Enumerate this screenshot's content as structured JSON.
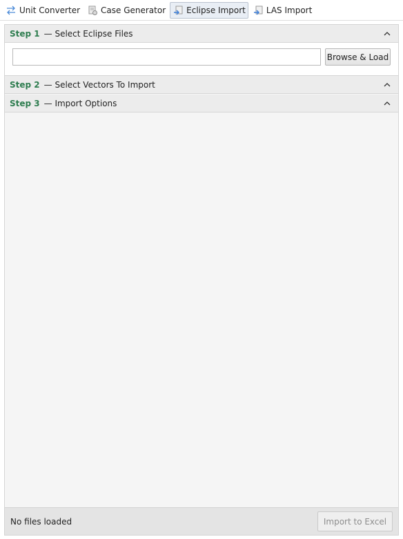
{
  "toolbar": {
    "items": [
      {
        "label": "Unit Converter",
        "icon": "swap-arrows-icon",
        "active": false
      },
      {
        "label": "Case Generator",
        "icon": "document-gear-icon",
        "active": false
      },
      {
        "label": "Eclipse Import",
        "icon": "import-file-icon",
        "active": true
      },
      {
        "label": "LAS Import",
        "icon": "import-file-icon",
        "active": false
      }
    ]
  },
  "steps": [
    {
      "number": "Step 1",
      "title": "— Select Eclipse Files",
      "expanded": true
    },
    {
      "number": "Step 2",
      "title": "— Select Vectors To Import",
      "expanded": false
    },
    {
      "number": "Step 3",
      "title": "— Import Options",
      "expanded": false
    }
  ],
  "step1": {
    "file_input_value": "",
    "browse_label": "Browse & Load"
  },
  "footer": {
    "status": "No files loaded",
    "import_label": "Import to Excel",
    "import_enabled": false
  },
  "colors": {
    "step_number": "#2e7d4f",
    "icon_blue": "#3b7dd8",
    "panel_bg": "#f5f5f5"
  }
}
